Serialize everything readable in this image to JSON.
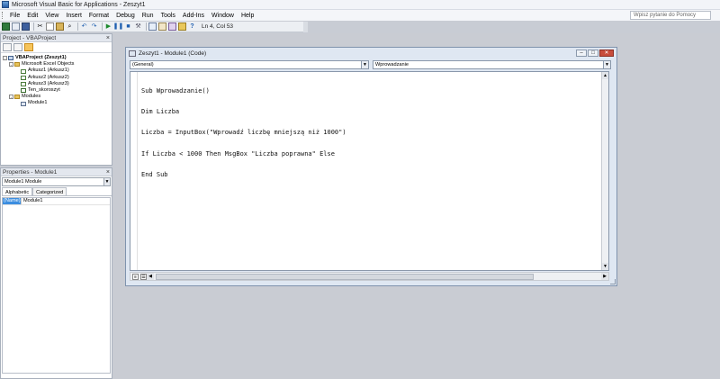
{
  "window": {
    "title": "Microsoft Visual Basic for Applications - Zeszyt1"
  },
  "menu": {
    "items": [
      "File",
      "Edit",
      "View",
      "Insert",
      "Format",
      "Debug",
      "Run",
      "Tools",
      "Add-Ins",
      "Window",
      "Help"
    ],
    "help_placeholder": "Wpisz pytanie do Pomocy"
  },
  "toolbar": {
    "status": "Ln 4, Col 53"
  },
  "project_panel": {
    "title": "Project - VBAProject",
    "close": "×",
    "tree": {
      "root": "VBAProject (Zeszyt1)",
      "objects_folder": "Microsoft Excel Objects",
      "sheets": [
        "Arkusz1 (Arkusz1)",
        "Arkusz2 (Arkusz2)",
        "Arkusz3 (Arkusz3)"
      ],
      "workbook": "Ten_skoroszyt",
      "modules_folder": "Modules",
      "modules": [
        "Module1"
      ]
    }
  },
  "properties_panel": {
    "title": "Properties - Module1",
    "close": "×",
    "object_select": "Module1 Module",
    "tabs": [
      "Alphabetic",
      "Categorized"
    ],
    "rows": [
      {
        "name": "(Name)",
        "value": "Module1"
      }
    ]
  },
  "code_window": {
    "title": "Zeszyt1 - Module1 (Code)",
    "object_combo": "(General)",
    "procedure_combo": "Wprowadzanie",
    "lines": [
      "Sub Wprowadzanie()",
      "Dim Liczba",
      "Liczba = InputBox(\"Wprowadź liczbę mniejszą niż 1000\")",
      "If Liczba < 1000 Then MsgBox \"Liczba poprawna\" Else",
      "End Sub"
    ]
  },
  "colors": {
    "selection": "#3c8ee0",
    "close_button": "#c84d3c"
  }
}
